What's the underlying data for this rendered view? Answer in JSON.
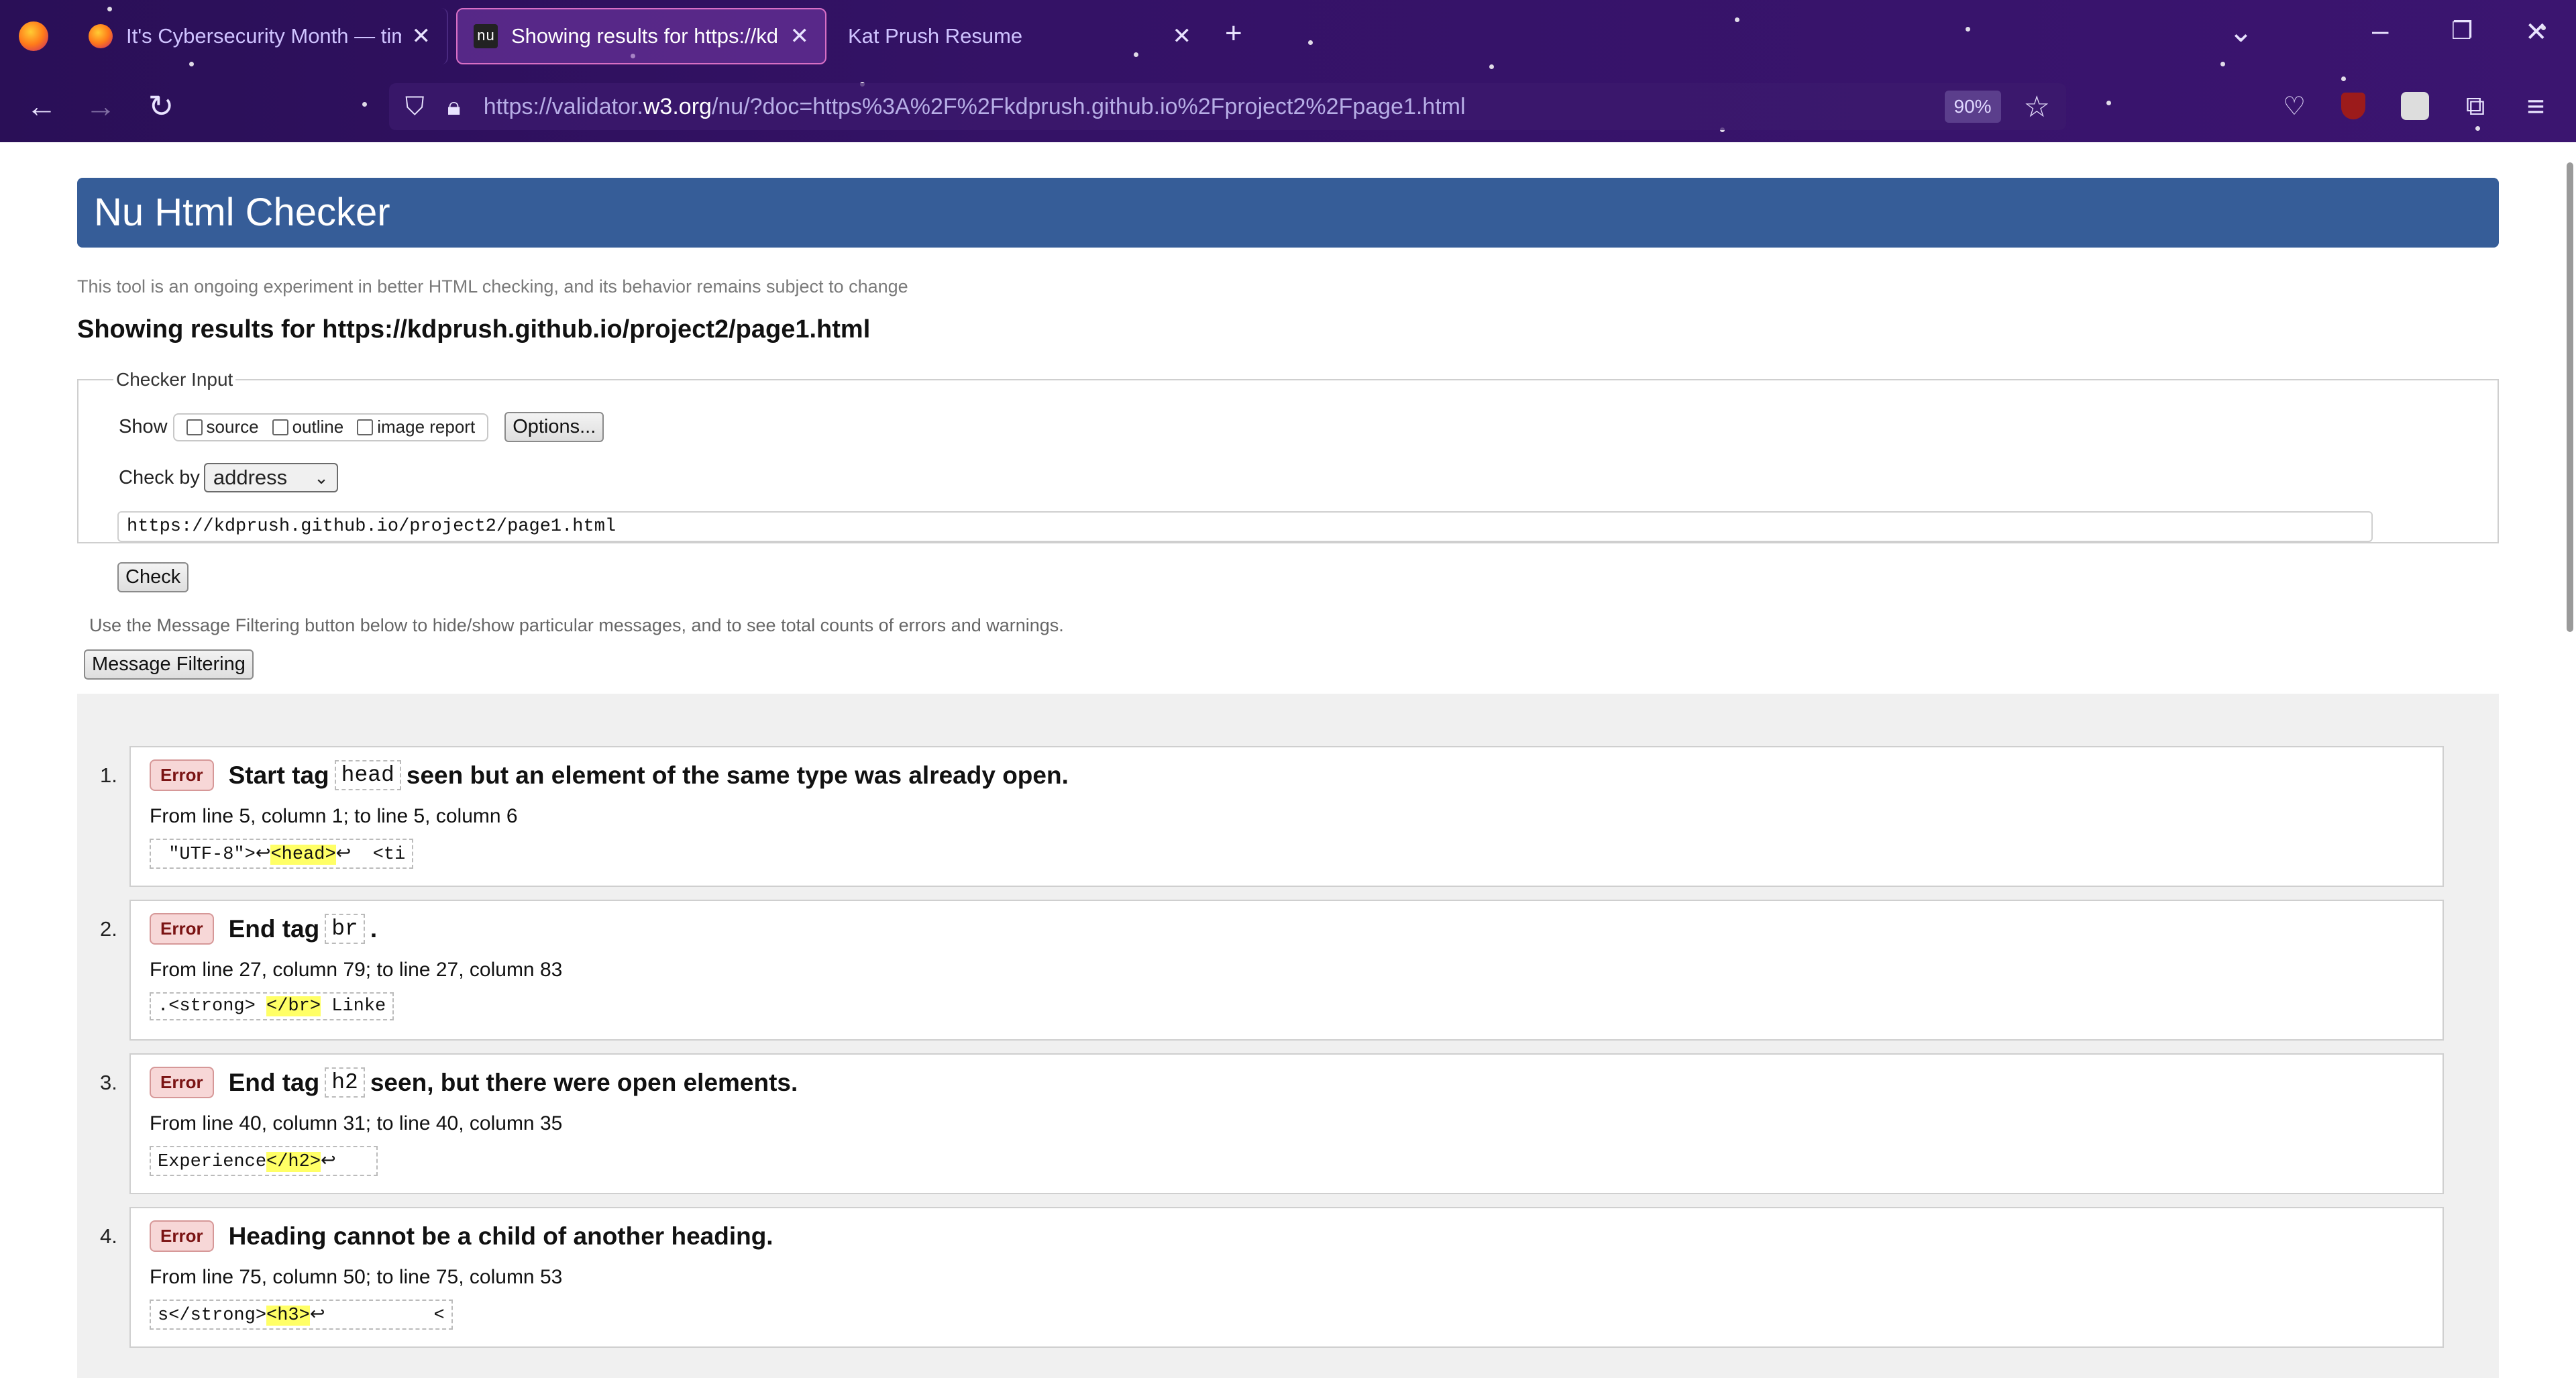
{
  "browser": {
    "tabs": [
      {
        "title": "It's Cybersecurity Month — tim",
        "active": false
      },
      {
        "title": "Showing results for https://kdp",
        "favicon_text": "nu",
        "active": true
      },
      {
        "title": "Kat Prush Resume",
        "active": false
      }
    ],
    "url_prefix": "https://validator.",
    "url_domain": "w3.org",
    "url_suffix": "/nu/?doc=https%3A%2F%2Fkdprush.github.io%2Fproject2%2Fpage1.html",
    "zoom": "90%"
  },
  "page": {
    "banner_title": "Nu Html Checker",
    "tagline": "This tool is an ongoing experiment in better HTML checking, and its behavior remains subject to change",
    "results_heading": "Showing results for https://kdprush.github.io/project2/page1.html",
    "checker": {
      "legend": "Checker Input",
      "show_label": "Show",
      "show_options": [
        "source",
        "outline",
        "image report"
      ],
      "options_button": "Options...",
      "check_by_label": "Check by",
      "check_by_value": "address",
      "address_value": "https://kdprush.github.io/project2/page1.html",
      "check_button": "Check"
    },
    "filter_hint": "Use the Message Filtering button below to hide/show particular messages, and to see total counts of errors and warnings.",
    "filter_button": "Message Filtering",
    "messages": [
      {
        "num": "1.",
        "badge": "Error",
        "pre": "Start tag",
        "code": "head",
        "post": "seen but an element of the same type was already open.",
        "location": "From line 5, column 1; to line 5, column 6",
        "extract_before": " \"UTF-8\">↩",
        "extract_hl": "<head>",
        "extract_after": "↩  <ti"
      },
      {
        "num": "2.",
        "badge": "Error",
        "pre": "End tag",
        "code": "br",
        "post": ".",
        "location": "From line 27, column 79; to line 27, column 83",
        "extract_before": ".<strong> ",
        "extract_hl": "</br>",
        "extract_after": " Linke"
      },
      {
        "num": "3.",
        "badge": "Error",
        "pre": "End tag",
        "code": "h2",
        "post": "seen, but there were open elements.",
        "location": "From line 40, column 31; to line 40, column 35",
        "extract_before": "Experience",
        "extract_hl": "</h2>",
        "extract_after": "↩"
      },
      {
        "num": "4.",
        "badge": "Error",
        "pre": "Heading cannot be a child of another heading.",
        "code": "",
        "post": "",
        "location": "From line 75, column 50; to line 75, column 53",
        "extract_before": "s</strong>",
        "extract_hl": "<h3>",
        "extract_after": "↩          <"
      }
    ]
  }
}
